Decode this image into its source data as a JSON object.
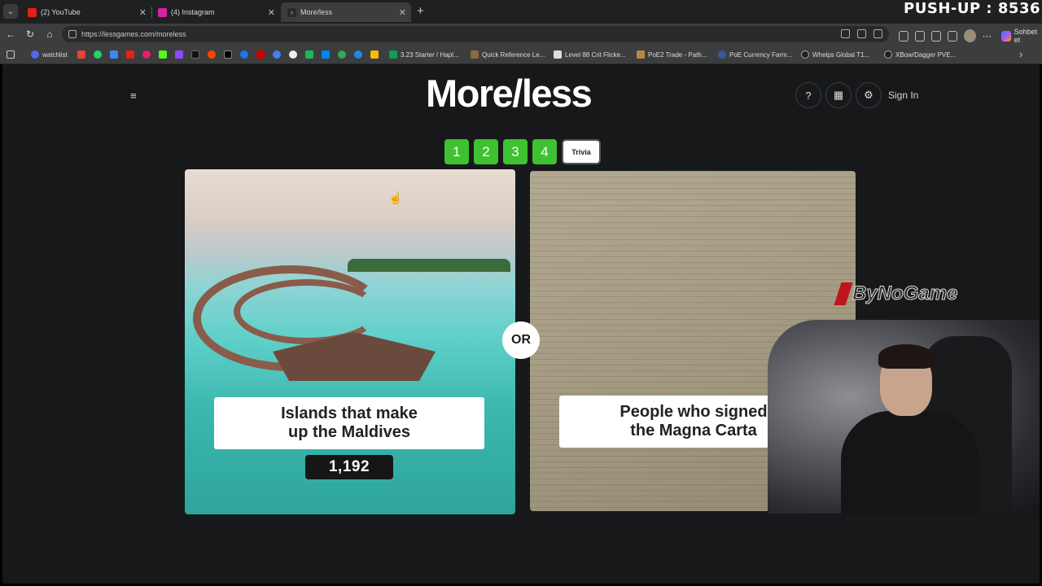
{
  "overlay": {
    "pushup": "PUSH-UP : 8536"
  },
  "browser": {
    "tabs": [
      {
        "title": "(2) YouTube",
        "color": "#e62117"
      },
      {
        "title": "(4) Instagram",
        "color": "#d6249f"
      },
      {
        "title": "More/less",
        "color": "#f4c20d"
      }
    ],
    "url": "https://lessgames.com/moreless",
    "profile_button": "Sohbet et",
    "bookmarks": [
      {
        "label": "watchlist"
      },
      {
        "label": "3.23 Starter / Hapl..."
      },
      {
        "label": "Quick Reference Le..."
      },
      {
        "label": "Level 88 Crit Flicke..."
      },
      {
        "label": "PoE2 Trade - Path..."
      },
      {
        "label": "PoE Currency Farm..."
      },
      {
        "label": "Whelps Global T1..."
      },
      {
        "label": "XBow/Dagger PVE..."
      }
    ]
  },
  "site": {
    "logo": "More/less",
    "help": "?",
    "signin": "Sign In",
    "levels": [
      "1",
      "2",
      "3",
      "4"
    ],
    "trivia": "Trivia",
    "or": "OR",
    "left_card": {
      "title_line1": "Islands that make",
      "title_line2": "up the Maldives",
      "value": "1,192"
    },
    "right_card": {
      "title_line1": "People who signed",
      "title_line2": "the Magna Carta"
    },
    "accent": "#3ec232"
  },
  "stream": {
    "watermark": "ByNoGame",
    "watermark_color": "#c0141c"
  }
}
